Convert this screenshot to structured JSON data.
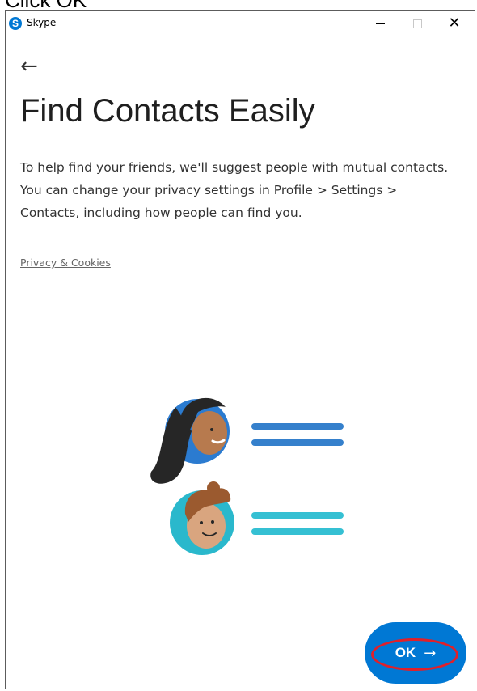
{
  "instruction": "Click OK",
  "window": {
    "title": "Skype",
    "app_icon_letter": "S",
    "minimize_glyph": "—",
    "close_glyph": "✕"
  },
  "page": {
    "back_glyph": "←",
    "heading": "Find Contacts Easily",
    "description": "To help find your friends, we'll suggest people with mutual contacts. You can change your privacy settings in Profile > Settings > Contacts, including how people can find you.",
    "privacy_link": "Privacy & Cookies"
  },
  "illustration": {
    "icon": "contacts-illustration",
    "colors": {
      "person1_circle": "#2b7bd0",
      "person1_lines": "#3580cc",
      "person2_circle": "#2ab8cc",
      "person2_lines": "#35c0d3"
    }
  },
  "ok_button": {
    "label": "OK",
    "arrow_glyph": "→",
    "color": "#0078d4",
    "highlight_color": "#e0202a"
  }
}
